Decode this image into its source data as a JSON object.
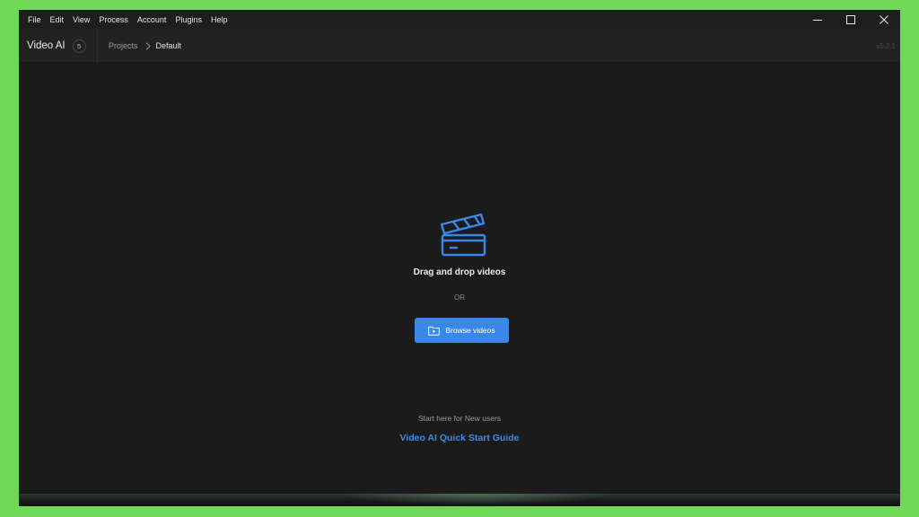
{
  "menu": {
    "items": [
      "File",
      "Edit",
      "View",
      "Process",
      "Account",
      "Plugins",
      "Help"
    ]
  },
  "window_controls": {
    "icons": [
      "minimize-icon",
      "maximize-icon",
      "close-icon"
    ]
  },
  "header": {
    "app_name": "Video AI",
    "badge_count": "5",
    "breadcrumb_parent": "Projects",
    "breadcrumb_current": "Default",
    "version": "v5.2.1"
  },
  "main": {
    "drop_icon": "clapperboard-icon",
    "drop_text": "Drag and drop videos",
    "or_text": "OR",
    "browse_label": "Browse videos",
    "browse_icon": "folder-video-icon",
    "start_text": "Start here for New users",
    "guide_link": "Video AI Quick Start Guide"
  },
  "colors": {
    "accent": "#3b87e8",
    "background": "#1b1b1b",
    "frame": "#6fd957"
  }
}
